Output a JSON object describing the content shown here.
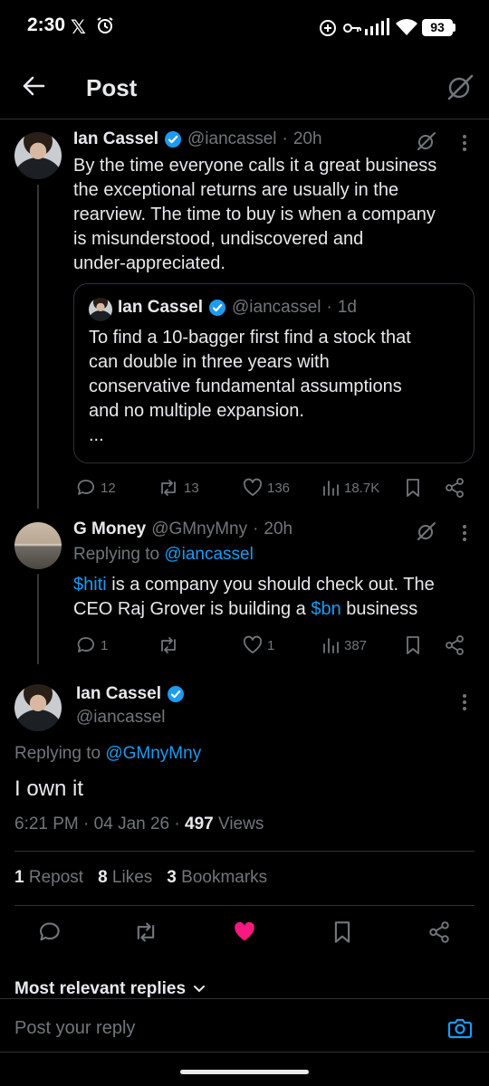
{
  "status_bar": {
    "time": "2:30",
    "x_glyph": "𝕏",
    "battery": "93"
  },
  "header": {
    "title": "Post"
  },
  "post1": {
    "name": "Ian Cassel",
    "handle": "@iancassel",
    "time": "20h",
    "lines": [
      "By the time everyone calls it a great business",
      "the exceptional returns are usually in the",
      "rearview. The time to buy is when a company",
      "is misunderstood, undiscovered and",
      "under-appreciated."
    ],
    "quote": {
      "name": "Ian Cassel",
      "handle": "@iancassel",
      "time": "1d",
      "lines": [
        "To find a 10-bagger first find a stock that",
        "can double in three years with",
        "conservative fundamental assumptions",
        "and no multiple expansion.",
        "..."
      ]
    },
    "replies": "12",
    "reposts": "13",
    "likes": "136",
    "views": "18.7K"
  },
  "post2": {
    "name": "G Money",
    "handle": "@GMnyMny",
    "time": "20h",
    "replying_prefix": "Replying to",
    "replying_to": "@iancassel",
    "line1_cashtag": "$hiti",
    "line1_rest": " is a company you should check out.  The",
    "line2_pre": "CEO Raj Grover is building a ",
    "line2_cashtag": "$bn",
    "line2_post": " business",
    "replies": "1",
    "reposts": "",
    "likes": "1",
    "views": "387"
  },
  "main": {
    "name": "Ian Cassel",
    "handle": "@iancassel",
    "replying_prefix": "Replying to",
    "replying_to": "@GMnyMny",
    "text": "I own it",
    "time": "6:21 PM",
    "date": "04 Jan 26",
    "views_count": "497",
    "views_label": "Views",
    "reposts_count": "1",
    "reposts_label": "Repost",
    "likes_count": "8",
    "likes_label": "Likes",
    "bookmarks_count": "3",
    "bookmarks_label": "Bookmarks"
  },
  "replies_sort": {
    "label": "Most relevant replies"
  },
  "composer": {
    "placeholder": "Post your reply"
  },
  "colors": {
    "accent": "#1d9bf0",
    "like": "#f91880",
    "muted": "#71767b",
    "background": "#000000"
  }
}
